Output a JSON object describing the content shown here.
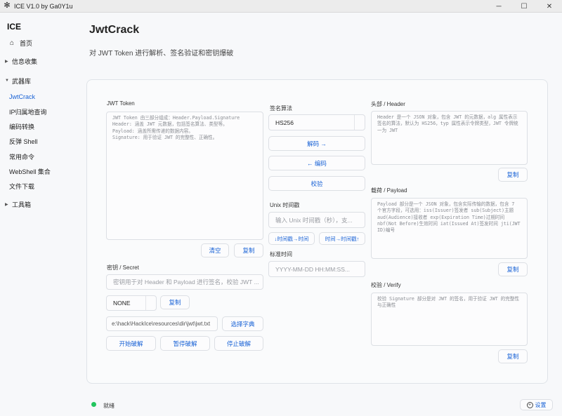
{
  "window": {
    "title": "ICE V1.0 by Ga0Y1u",
    "app_icon": "snowflake-icon",
    "minimize": "─",
    "maximize": "☐",
    "close": "✕"
  },
  "sidebar": {
    "brand": "ICE",
    "items": [
      {
        "label": "首页",
        "icon": "home-icon",
        "icon_glyph": "⌂"
      },
      {
        "label": "信息收集",
        "arrow": "▶"
      },
      {
        "label": "武器库",
        "arrow": "▼"
      },
      {
        "label": "JwtCrack",
        "active": true
      },
      {
        "label": "IP归属地查询"
      },
      {
        "label": "编码转换"
      },
      {
        "label": "反弹 Shell"
      },
      {
        "label": "常用命令"
      },
      {
        "label": "WebShell 集合"
      },
      {
        "label": "文件下载"
      },
      {
        "label": "工具箱",
        "arrow": "▶"
      }
    ]
  },
  "page": {
    "title": "JwtCrack",
    "subtitle": "对 JWT Token 进行解析、签名验证和密钥爆破"
  },
  "jwt": {
    "label": "JWT Token",
    "placeholder": "JWT Token 由三部分组成：Header.Payload.Signature\nHeader: 涵盖 JWT 元数据，包括签名算法、类型等。\nPayload: 涵盖所需传递的数据内容。\nSignature: 用于验证 JWT 的完整性、正确性。",
    "clear": "清空",
    "copy": "复制"
  },
  "secret": {
    "label": "密钥 / Secret",
    "placeholder": "密钥用于对 Header 和 Payload 进行签名，校验 JWT ...",
    "mode": "NONE",
    "copy": "复制",
    "dict_path": "e:\\hack\\HackIce\\resources\\dir\\jwt\\jwt.txt",
    "choose_dict": "选择字典",
    "start": "开始破解",
    "pause": "暂停破解",
    "stop": "停止破解"
  },
  "algo": {
    "label": "签名算法",
    "value": "HS256",
    "decode": "解码 →",
    "encode": "← 编码",
    "verify": "校验"
  },
  "unix": {
    "label": "Unix 时间戳",
    "placeholder": "输入 Unix 时间戳（秒），支...",
    "to_time": "↓时间戳→时间",
    "to_stamp": "时间→时间戳↑"
  },
  "stdtime": {
    "label": "标准时间",
    "placeholder": "YYYY-MM-DD HH:MM:SS..."
  },
  "header": {
    "label": "头部 / Header",
    "placeholder": "Header 是一个 JSON 对象，包含 JWT 的元数据，alg 属性表示签名的算法，默认为 HS256，typ 属性表示令牌类型，JWT 令牌统一为 JWT",
    "copy": "复制"
  },
  "payload": {
    "label": "载荷 / Payload",
    "placeholder": "Payload 部分是一个 JSON 对象，包含实际传输的数据，包含 7 个官方字段，可选用：iss(Issuer)签发者 sub(Subject)主题 aud(Audience)接收者 exp(Expiration Time)过期时间 nbf(Not Before)生效时间 iat(Issued At)签发时间 jti(JWT ID)编号",
    "copy": "复制"
  },
  "verify": {
    "label": "校验 / Verify",
    "placeholder": "校验 Signature 部分是对 JWT 的签名，用于验证 JWT 的完整性与正确性",
    "copy": "复制"
  },
  "status": {
    "text": "就绪",
    "color": "#22c55e"
  },
  "settings": {
    "label": "设置",
    "icon": "plus-circle-icon",
    "glyph": "+"
  }
}
